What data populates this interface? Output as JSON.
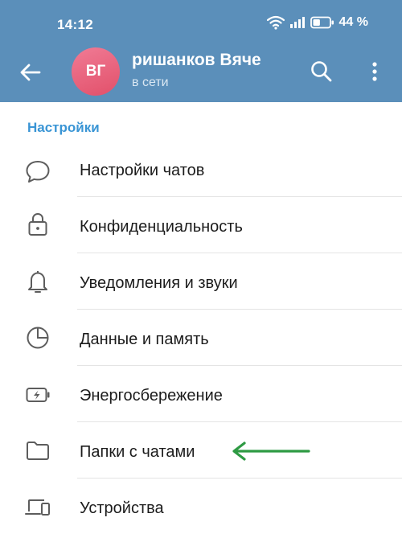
{
  "status_bar": {
    "time": "14:12",
    "battery_percent": "44 %",
    "battery_level": 0.44
  },
  "chat_header": {
    "avatar_initials": "ВГ",
    "avatar_color": "#e95c77",
    "name": "ришанков  Вяче",
    "status": "в сети",
    "header_color": "#5b8fba"
  },
  "settings": {
    "section_title": "Настройки",
    "items": [
      {
        "label": "Настройки чатов",
        "icon": "chat-bubble-icon"
      },
      {
        "label": "Конфиденциальность",
        "icon": "lock-icon"
      },
      {
        "label": "Уведомления и звуки",
        "icon": "bell-icon"
      },
      {
        "label": "Данные и память",
        "icon": "pie-chart-icon"
      },
      {
        "label": "Энергосбережение",
        "icon": "battery-charging-icon"
      },
      {
        "label": "Папки с чатами",
        "icon": "folder-icon"
      },
      {
        "label": "Устройства",
        "icon": "devices-icon"
      }
    ]
  },
  "annotation": {
    "arrow_color": "#2e9a43",
    "target": "Папки с чатами"
  }
}
